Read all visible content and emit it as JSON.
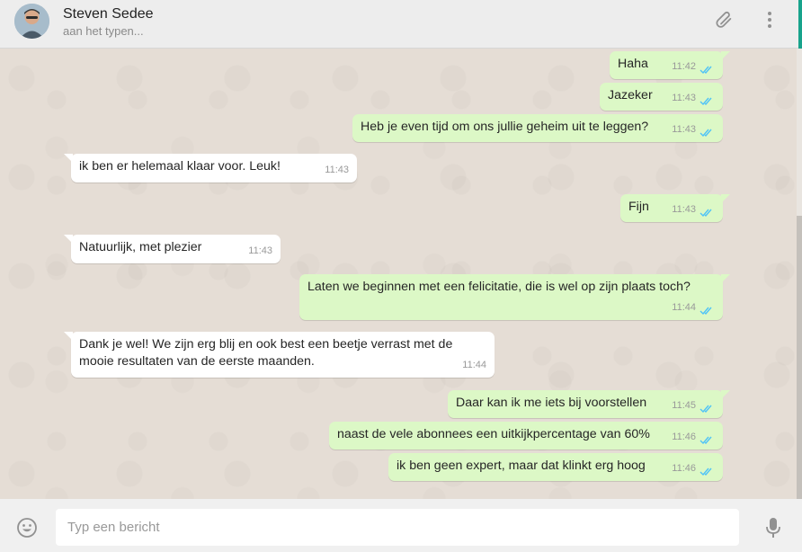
{
  "header": {
    "contact_name": "Steven Sedee",
    "contact_status": "aan het typen...",
    "icons": [
      "paperclip-icon",
      "more-vertical-icon"
    ]
  },
  "messages": [
    {
      "direction": "out",
      "text": "Haha",
      "time": "11:42",
      "status": "read"
    },
    {
      "direction": "out",
      "text": "Jazeker",
      "time": "11:43",
      "status": "read"
    },
    {
      "direction": "out",
      "text": "Heb je even tijd om ons jullie geheim uit te leggen?",
      "time": "11:43",
      "status": "read"
    },
    {
      "direction": "in",
      "text": "ik ben er helemaal klaar voor. Leuk!",
      "time": "11:43"
    },
    {
      "direction": "out",
      "text": "Fijn",
      "time": "11:43",
      "status": "read"
    },
    {
      "direction": "in",
      "text": "Natuurlijk, met plezier",
      "time": "11:43"
    },
    {
      "direction": "out",
      "text": "Laten we beginnen met een felicitatie, die is wel op zijn plaats toch?",
      "time": "11:44",
      "status": "read"
    },
    {
      "direction": "in",
      "text": "Dank je wel! We zijn erg blij en ook best een beetje verrast met de mooie resultaten van de eerste maanden.",
      "time": "11:44"
    },
    {
      "direction": "out",
      "text": "Daar kan ik me iets bij voorstellen",
      "time": "11:45",
      "status": "read"
    },
    {
      "direction": "out",
      "text": "naast de vele abonnees een uitkijkpercentage van 60%",
      "time": "11:46",
      "status": "read"
    },
    {
      "direction": "out",
      "text": "ik ben geen expert, maar dat klinkt erg hoog",
      "time": "11:46",
      "status": "read"
    }
  ],
  "composer": {
    "placeholder": "Typ een bericht",
    "value": ""
  },
  "colors": {
    "outgoing_bubble": "#dcf8c6",
    "incoming_bubble": "#ffffff",
    "chat_background": "#e5ddd5",
    "read_ticks": "#4fc3f7",
    "accent": "#18a38c"
  }
}
